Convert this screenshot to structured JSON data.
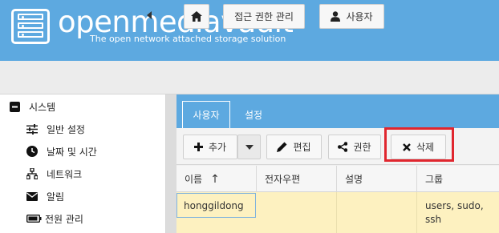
{
  "app": {
    "brand": "openmediavault",
    "tagline": "The open network attached storage solution"
  },
  "breadcrumb": {
    "home_icon": "home-icon",
    "access_label": "접근 권한 관리",
    "user_label": "사용자",
    "user_icon": "user-icon"
  },
  "sidebar": {
    "items": [
      {
        "label": "시스템",
        "icon": "minus-square-icon"
      },
      {
        "label": "일반 설정",
        "icon": "sliders-icon"
      },
      {
        "label": "날짜 및 시간",
        "icon": "clock-icon"
      },
      {
        "label": "네트워크",
        "icon": "network-icon"
      },
      {
        "label": "알림",
        "icon": "envelope-icon"
      },
      {
        "label": "전원 관리",
        "icon": "battery-icon"
      }
    ]
  },
  "tabs": [
    {
      "label": "사용자",
      "active": true
    },
    {
      "label": "설정",
      "active": false
    }
  ],
  "actions": {
    "add_label": "추가",
    "edit_label": "편집",
    "perm_label": "권한",
    "delete_label": "삭제"
  },
  "table": {
    "columns": [
      "이름",
      "전자우편",
      "설명",
      "그룹"
    ],
    "sort_indicator": "↑",
    "rows": [
      {
        "name": "honggildong",
        "email": "",
        "description": "",
        "groups": "users, sudo, ssh"
      }
    ]
  },
  "colors": {
    "header_blue": "#5da9e0",
    "highlight_red": "#e0262e",
    "row_selected": "#fdf1c0"
  }
}
